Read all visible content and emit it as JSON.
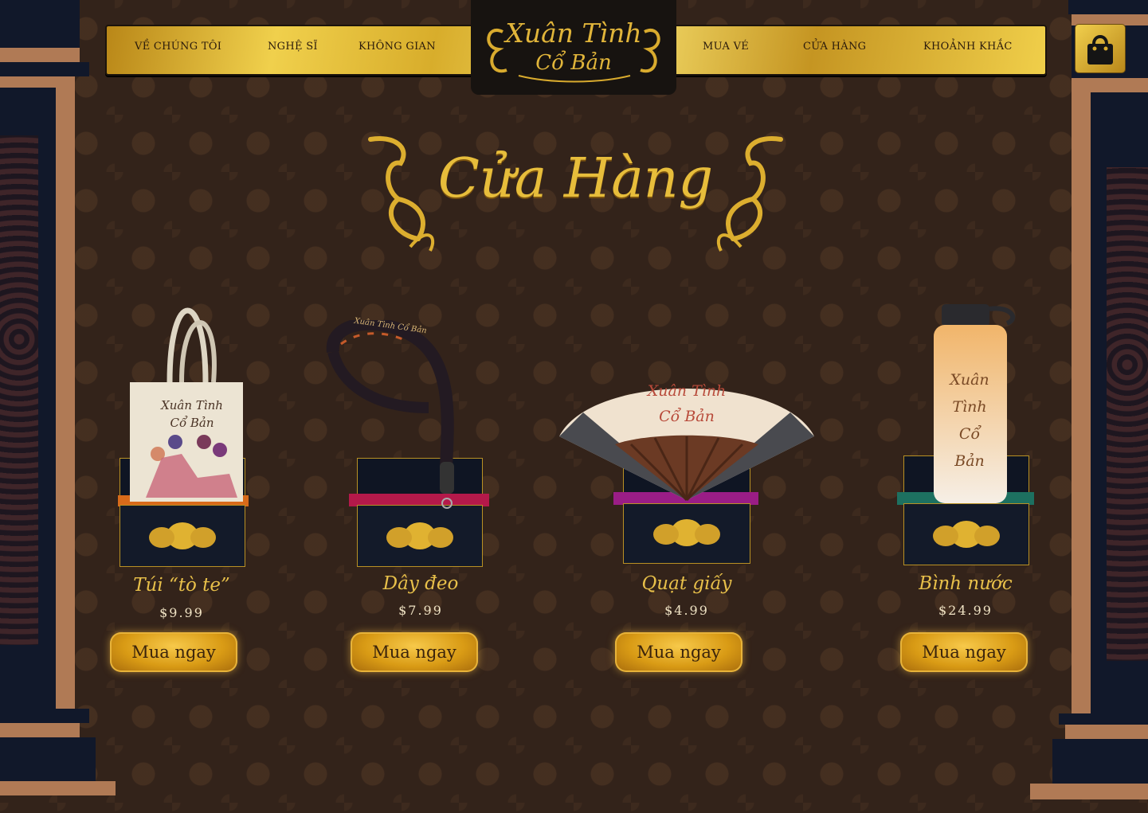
{
  "header": {
    "nav_left": [
      "VỀ CHÚNG TÔI",
      "NGHỆ SĨ",
      "KHÔNG GIAN"
    ],
    "nav_right": [
      "MUA VÉ",
      "CỬA HÀNG",
      "KHOẢNH KHẮC"
    ],
    "logo_line1": "Xuân Tình",
    "logo_line2": "Cổ Bản",
    "cart_icon": "shopping-bag-icon"
  },
  "page": {
    "title": "Cửa Hàng"
  },
  "products": [
    {
      "name": "Túi “tò te”",
      "price": "$9.99",
      "button": "Mua ngay",
      "image_text1": "Xuân Tình",
      "image_text2": "Cổ Bản",
      "accent": "#d86a1a"
    },
    {
      "name": "Dây đeo",
      "price": "$7.99",
      "button": "Mua ngay",
      "image_text1": "Xuân Tình Cổ Bản",
      "accent": "#b4194a"
    },
    {
      "name": "Quạt giấy",
      "price": "$4.99",
      "button": "Mua ngay",
      "image_text1": "Xuân Tình",
      "image_text2": "Cổ Bản",
      "accent": "#9a1d86"
    },
    {
      "name": "Bình nước",
      "price": "$24.99",
      "button": "Mua ngay",
      "image_text1": "Xuân",
      "image_text2": "Tình",
      "image_text3": "Cổ",
      "image_text4": "Bản",
      "accent": "#1d7060"
    }
  ],
  "colors": {
    "background": "#33231a",
    "gold": "#e7bd3b",
    "pillar": "#11182a",
    "pillar_trim": "#b07a55"
  }
}
